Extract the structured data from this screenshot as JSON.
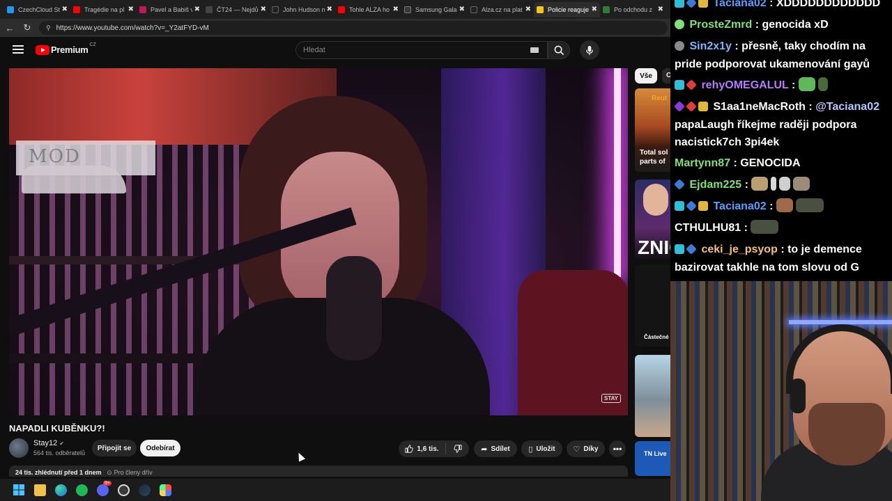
{
  "browser": {
    "tabs": [
      {
        "title": "CzechCloud St",
        "color": "#2196f3"
      },
      {
        "title": "Tragédie na pl",
        "color": "#ff0000"
      },
      {
        "title": "Pavel a Babiš v",
        "color": "#c2185b"
      },
      {
        "title": "ČT24 — Nejdů",
        "color": "#444444"
      },
      {
        "title": "John Hudson n",
        "color": "#222222"
      },
      {
        "title": "Tohle ALZA ho",
        "color": "#ff0000"
      },
      {
        "title": "Samsung Gala",
        "color": "#3a3a3a"
      },
      {
        "title": "Alza.cz na plat",
        "color": "#222222"
      },
      {
        "title": "Policie reaguje",
        "color": "#f5c518",
        "active": true
      },
      {
        "title": "Po odchodu z",
        "color": "#2e7d32"
      }
    ],
    "tab_close": "✖",
    "url": "https://www.youtube.com/watch?v=_Y2atFYD-vM"
  },
  "youtube": {
    "logo_text": "Premium",
    "logo_region": "CZ",
    "search_placeholder": "Hledat",
    "video_watermark": "STAY",
    "video_title": "NAPADLI KUBĚNKU?!",
    "channel_name": "Stay12",
    "channel_subs": "564 tis. odběratelů",
    "join_label": "Připojit se",
    "subscribe_label": "Odebírat",
    "like_count": "1,6 tis.",
    "share_label": "Sdílet",
    "save_label": "Uložit",
    "thanks_label": "Díky",
    "more_label": "•••",
    "views": "24 tis. zhlédnutí",
    "published": "před 1 dnem",
    "members_only": "Pro členy dřív",
    "chips": {
      "all": "Vše",
      "next": "O"
    },
    "rail": {
      "thumb1_brand": "Reut",
      "thumb1_title": "Total sol parts of",
      "thumb2_text": "ZNIČ",
      "thumb3_tag": "Částečné",
      "thumb5_tag": "TN Live"
    }
  },
  "chat": {
    "messages": [
      {
        "user": "Taciana02",
        "user_color": "#5aa0ff",
        "text": "XDDDDDDDDDDDD"
      },
      {
        "user": "ProsteZmrd",
        "user_color": "#7fe07a",
        "text": "genocida xD"
      },
      {
        "user": "Sin2x1y",
        "user_color": "#7ab8ff",
        "text": "přesně, taky chodím na"
      },
      {
        "user": "",
        "user_color": "#ffffff",
        "text": "pride podporovat ukamenování gayů"
      },
      {
        "user": "rehyOMEGALUL",
        "user_color": "#b57cff",
        "text": ""
      },
      {
        "user": "S1aa1neMacRoth",
        "user_color": "#ffffff",
        "text": "@Taciana02"
      },
      {
        "user": "",
        "user_color": "#ffffff",
        "text": "papaLaugh říkejme raději podpora"
      },
      {
        "user": "",
        "user_color": "#ffffff",
        "text": "nacistick7ch 3pi4ek"
      },
      {
        "user": "Martynn87",
        "user_color": "#7fe07a",
        "text": "GENOCIDA"
      },
      {
        "user": "Ejdam225",
        "user_color": "#7fe07a",
        "text": ""
      },
      {
        "user": "Taciana02",
        "user_color": "#5aa0ff",
        "text": ""
      },
      {
        "user": "CTHULHU81",
        "user_color": "#ffffff",
        "text": ""
      },
      {
        "user": "ceki_je_psyop",
        "user_color": "#f5c07a",
        "text": "to je demence"
      },
      {
        "user": "",
        "user_color": "#ffffff",
        "text": "bazirovat takhle na tom slovu od G"
      }
    ],
    "separator": ":"
  },
  "taskbar": {
    "icons": [
      "windows-start-icon",
      "file-explorer-icon",
      "edge-icon",
      "spotify-icon",
      "discord-icon",
      "obs-icon",
      "steam-icon",
      "app-icon"
    ],
    "discord_badge": "9+"
  },
  "colors": {
    "youtube_red": "#ff0000",
    "background": "#0f0f0f",
    "chip_bg": "#272727"
  }
}
